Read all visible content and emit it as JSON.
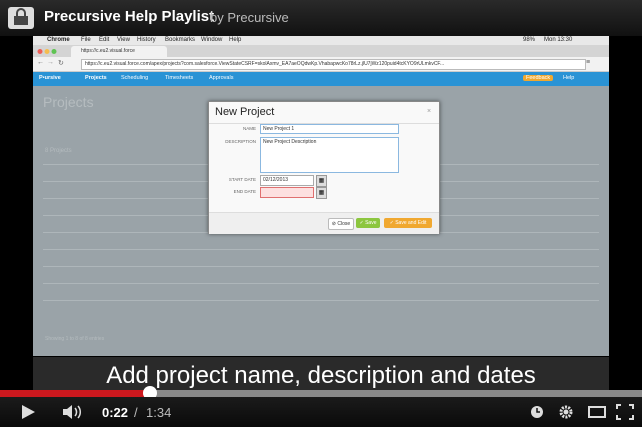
{
  "player": {
    "title": "Precursive Help Playlist",
    "channel": "by Precursive",
    "caption": "Add project name, description and dates",
    "current_time": "0:22",
    "time_separator": "/",
    "duration": "1:34",
    "progress_fraction": 0.234,
    "buffered_fraction": 1.0
  },
  "macos": {
    "menu_items": [
      "Chrome",
      "File",
      "Edit",
      "View",
      "History",
      "Bookmarks",
      "Window",
      "Help"
    ],
    "battery": "98%",
    "clock": "Mon 13:30"
  },
  "browser": {
    "tab_title": "https://c.eu2.visual.force",
    "url": "https://c.eu2.visual.force.com/apex/projects?com.salesforce.ViewStateCSRF=skolAxmv_EA7aeOQdwKp.VhabapwcKo78rLz.jlU7jWz120puid4tcKYO9rULmkvCF..."
  },
  "app": {
    "nav": [
      "Projects",
      "Scheduling",
      "Timesheets",
      "Approvals"
    ],
    "page_title": "Projects",
    "count_label": "8 Projects",
    "footer_text": "Showing 1 to 8 of 8 entries",
    "feedback_label": "Feedback",
    "help_label": "Help"
  },
  "modal": {
    "title": "New Project",
    "close": "×",
    "name_label": "NAME",
    "name_value": "New Project 1",
    "description_label": "DESCRIPTION",
    "description_value": "New Project Description",
    "start_label": "START DATE",
    "start_value": "02/12/2013",
    "end_label": "END DATE",
    "end_value": "",
    "close_btn": "Close",
    "save_btn": "Save",
    "save_edit_btn": "Save and Edit"
  },
  "colors": {
    "played": "#cc181e",
    "nav_bar": "#2a93d5",
    "save_btn": "#8cc63f",
    "save_edit_btn": "#f0a830"
  }
}
